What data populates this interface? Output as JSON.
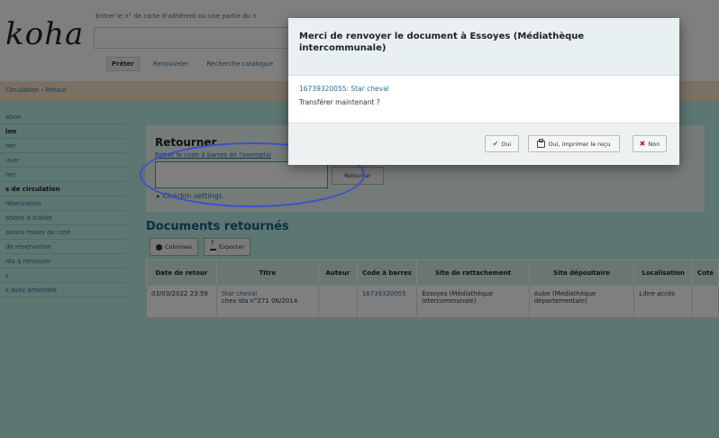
{
  "header": {
    "logo": "koha",
    "search_hint": "Entrer le n° de carte d'adhérent ou une partie du n",
    "tabs": [
      "Prêter",
      "Renouveler",
      "Recherche catalogue"
    ]
  },
  "breadcrumb": "Circulation › Retour",
  "sidebar": {
    "items": [
      {
        "label": "ation",
        "section": false
      },
      {
        "label": "ion",
        "section": true
      },
      {
        "label": "ner",
        "section": false
      },
      {
        "label": "uver",
        "section": false
      },
      {
        "label": "ner",
        "section": false
      },
      {
        "label": "s de circulation",
        "section": true
      },
      {
        "label": "réservation",
        "section": false
      },
      {
        "label": "ations à traiter",
        "section": false
      },
      {
        "label": "ations mises de coté",
        "section": false
      },
      {
        "label": "de réservation",
        "section": false
      },
      {
        "label": "nts à renvoyer",
        "section": false
      },
      {
        "label": "s",
        "section": false
      },
      {
        "label": "s avec amendes",
        "section": false
      }
    ]
  },
  "checkin": {
    "title": "Retourner",
    "subtitle": "Entrer le code à barres de l'exemplai",
    "input_value": "",
    "submit_label": "Retourner",
    "settings_link": "Checkin settings"
  },
  "returned": {
    "title": "Documents retournés",
    "buttons": {
      "columns": "Colonnes",
      "export": "Exporter"
    },
    "columns": [
      "Date de retour",
      "Titre",
      "Auteur",
      "Code à barres",
      "Site de rattachement",
      "Site dépositaire",
      "Localisation",
      "Cote"
    ],
    "rows": [
      {
        "date": "03/03/2022 23:59",
        "title": "Star cheval",
        "title_extra": "chev sta n°271 06/2014",
        "author": "",
        "barcode": "16739320055",
        "home_library": "Essoyes (Médiathèque intercommunale)",
        "holding_library": "Aube (Médiathèque départementale)",
        "location": "Libre accès",
        "callnumber": ""
      }
    ]
  },
  "modal": {
    "title": "Merci de renvoyer le document à Essoyes (Médiathèque intercommunale)",
    "item_link": "16739320055: Star cheval",
    "question": "Transférer maintenant ?",
    "buttons": {
      "yes": "Oui",
      "print": "Oui, imprimer le reçu",
      "no": "Non"
    }
  },
  "colors": {
    "accent": "#2a6f9f",
    "overlay": "#000000",
    "annotation": "#3a50d0",
    "sidebar_bg": "#b9ece3"
  }
}
